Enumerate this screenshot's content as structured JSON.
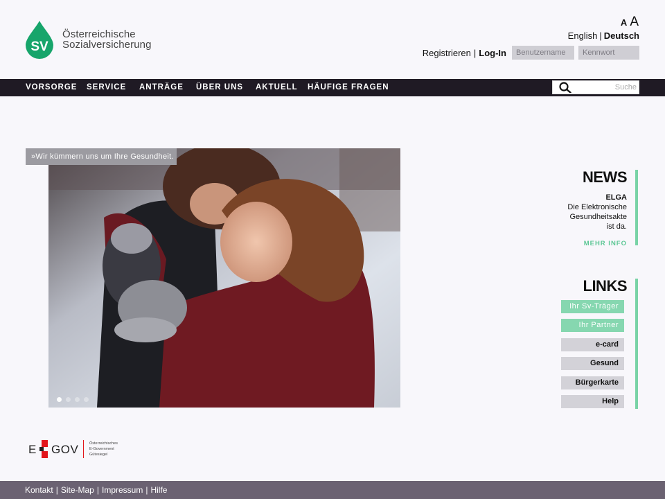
{
  "header": {
    "logo_initials": "SV",
    "logo_line1": "Österreichische",
    "logo_line2": "Sozialversicherung",
    "font_small": "A",
    "font_large": "A",
    "lang_english": "English",
    "lang_deutsch": "Deutsch",
    "lang_sep": "|",
    "register": "Registrieren",
    "login_sep": "|",
    "login": "Log-In",
    "username_placeholder": "Benutzername",
    "password_placeholder": "Kennwort",
    "brand_green": "#17a56b"
  },
  "nav": {
    "items": [
      "VORSORGE",
      "SERVICE",
      "ANTRÄGE",
      "ÜBER UNS",
      "AKTUELL",
      "HÄUFIGE FRAGEN"
    ],
    "search_placeholder": "Suche"
  },
  "hero": {
    "tagline": "»Wir kümmern uns um Ihre Gesundheit.",
    "slides": 4,
    "active_slide": 1
  },
  "news": {
    "heading": "NEWS",
    "title": "ELGA",
    "text_lines": [
      "Die Elektronische",
      "Gesundheitsakte",
      "ist da."
    ],
    "more": "MEHR INFO"
  },
  "links": {
    "heading": "LINKS",
    "items": [
      "Ihr Sv-Träger",
      "Ihr Partner",
      "e-card",
      "Gesund",
      "Bürgerkarte",
      "Help"
    ]
  },
  "egov": {
    "e": "E",
    "gov": "GOV",
    "line1": "Österreichisches",
    "line2": "E-Government",
    "line3": "Gütesiegel"
  },
  "footer": {
    "links": [
      "Kontakt",
      "Site-Map",
      "Impressum",
      "Hilfe"
    ],
    "sep": "|"
  }
}
